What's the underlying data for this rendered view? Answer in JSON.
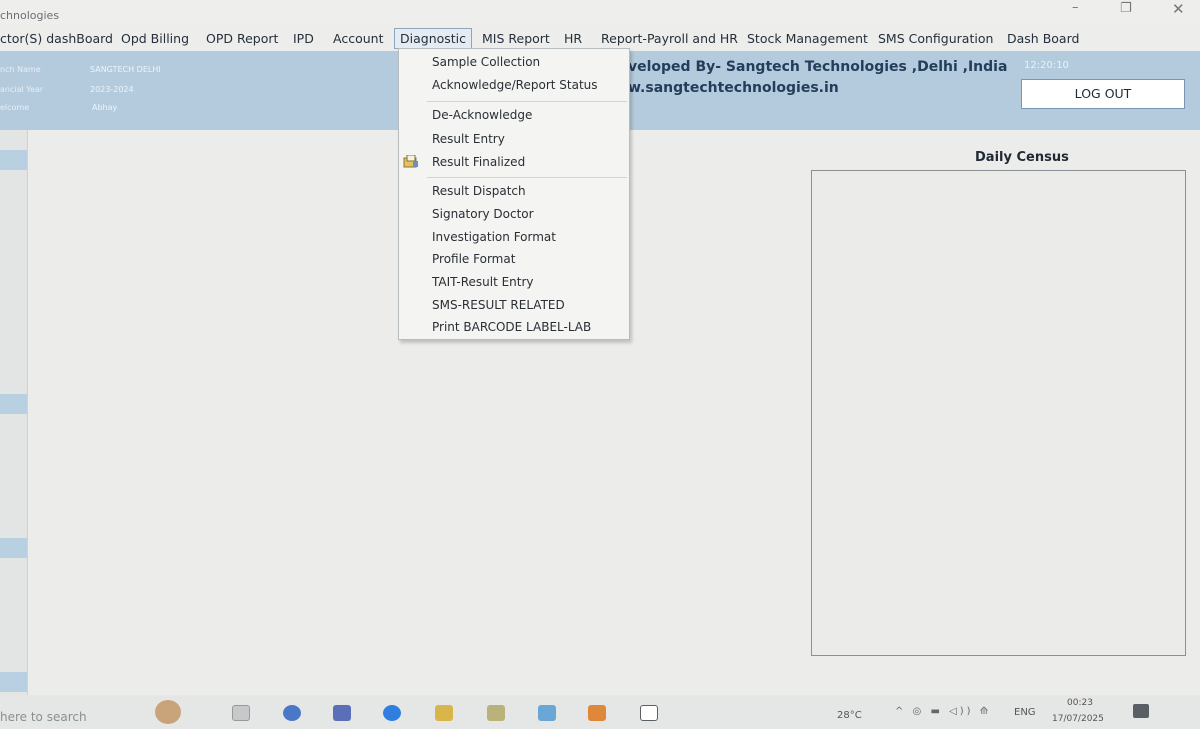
{
  "window": {
    "title": "chnologies",
    "controls": {
      "minimize": "–",
      "maximize": "❐",
      "close": "✕"
    }
  },
  "menubar": {
    "items": [
      {
        "label": "ctor(S) dashBoard"
      },
      {
        "label": "Opd Billing"
      },
      {
        "label": "OPD Report"
      },
      {
        "label": "IPD"
      },
      {
        "label": "Account"
      },
      {
        "label": "Diagnostic",
        "active": true
      },
      {
        "label": "MIS Report"
      },
      {
        "label": "HR"
      },
      {
        "label": "Report-Payroll and HR"
      },
      {
        "label": "Stock Management"
      },
      {
        "label": "SMS Configuration"
      },
      {
        "label": "Dash Board"
      }
    ]
  },
  "header": {
    "labels": [
      "nch Name",
      "ancial Year",
      "elcome"
    ],
    "branch_name": "SANGTECH DELHI",
    "financial_year": "2023-2024",
    "welcome_user": "Abhay",
    "developer_line": "veloped By- Sangtech Technologies ,Delhi ,India",
    "website_line": "w.sangtechtechnologies.in",
    "clock": "12:20:10",
    "logout_label": "LOG OUT"
  },
  "dropdown": {
    "menu": "Diagnostic",
    "items": [
      "Sample Collection",
      "Acknowledge/Report Status",
      "De-Acknowledge",
      "Result Entry",
      "Result Finalized",
      "Result Dispatch",
      "Signatory Doctor",
      "Investigation Format",
      "Profile Format",
      "TAIT-Result Entry",
      "SMS-RESULT RELATED",
      "Print BARCODE LABEL-LAB"
    ]
  },
  "census": {
    "title": "Daily Census"
  },
  "taskbar": {
    "search_placeholder": "here to search",
    "weather": "28°C",
    "language": "ENG",
    "time": "00:23",
    "date": "17/07/2025",
    "colors": {
      "chrome": "#3a7bd5",
      "edge": "#2aa7a1",
      "files": "#e8b84a"
    }
  }
}
